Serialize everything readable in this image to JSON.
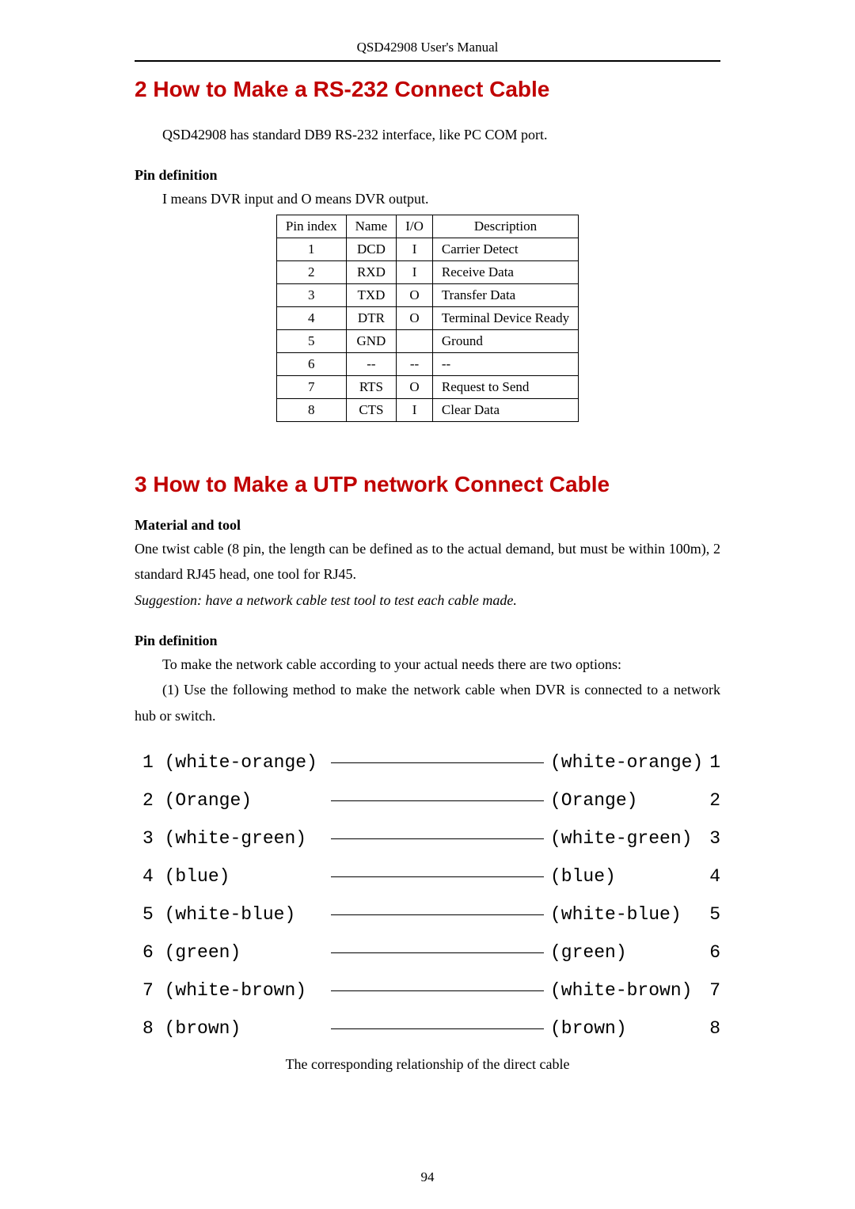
{
  "header": {
    "doc_title": "QSD42908 User's Manual"
  },
  "section2": {
    "heading": "2  How to Make a RS-232 Connect Cable",
    "intro": "QSD42908 has standard DB9 RS-232 interface, like PC COM port.",
    "pin_def_heading": "Pin definition",
    "pin_def_note": "I means DVR input and O means DVR output.",
    "table": {
      "headers": [
        "Pin index",
        "Name",
        "I/O",
        "Description"
      ],
      "rows": [
        {
          "idx": "1",
          "name": "DCD",
          "io": "I",
          "desc": "Carrier Detect"
        },
        {
          "idx": "2",
          "name": "RXD",
          "io": "I",
          "desc": "Receive Data"
        },
        {
          "idx": "3",
          "name": "TXD",
          "io": "O",
          "desc": "Transfer Data"
        },
        {
          "idx": "4",
          "name": "DTR",
          "io": "O",
          "desc": "Terminal Device Ready"
        },
        {
          "idx": "5",
          "name": "GND",
          "io": "",
          "desc": "Ground"
        },
        {
          "idx": "6",
          "name": "--",
          "io": "--",
          "desc": "--"
        },
        {
          "idx": "7",
          "name": "RTS",
          "io": "O",
          "desc": "Request to Send"
        },
        {
          "idx": "8",
          "name": "CTS",
          "io": "I",
          "desc": "Clear Data"
        }
      ]
    }
  },
  "section3": {
    "heading": "3  How to Make a UTP network Connect Cable",
    "mat_heading": "Material and tool",
    "mat_text": "One twist cable (8 pin, the length can be defined as to the actual demand, but must be within 100m), 2 standard RJ45 head, one tool for RJ45.",
    "suggestion": "Suggestion:    have a network cable test tool to test each cable made.",
    "pin_def_heading": "Pin definition",
    "pin_def_text1": "To make the network cable according to your actual needs there are two options:",
    "pin_def_text2": "(1) Use the following method to make the network cable when DVR is connected to a network hub or switch.",
    "wiring": [
      {
        "ln": "1",
        "ll": "(white-orange)",
        "rl": "(white-orange)",
        "rn": "1"
      },
      {
        "ln": "2",
        "ll": "(Orange)",
        "rl": "(Orange)",
        "rn": "2"
      },
      {
        "ln": "3",
        "ll": "(white-green)",
        "rl": "(white-green)",
        "rn": "3"
      },
      {
        "ln": "4",
        "ll": "(blue)",
        "rl": "(blue)",
        "rn": "4"
      },
      {
        "ln": "5",
        "ll": "(white-blue)",
        "rl": "(white-blue)",
        "rn": "5"
      },
      {
        "ln": "6",
        "ll": "(green)",
        "rl": "(green)",
        "rn": "6"
      },
      {
        "ln": "7",
        "ll": "(white-brown)",
        "rl": "(white-brown)",
        "rn": "7"
      },
      {
        "ln": "8",
        "ll": "(brown)",
        "rl": "(brown)",
        "rn": "8"
      }
    ],
    "caption": "The corresponding relationship of the direct cable"
  },
  "page_number": "94"
}
